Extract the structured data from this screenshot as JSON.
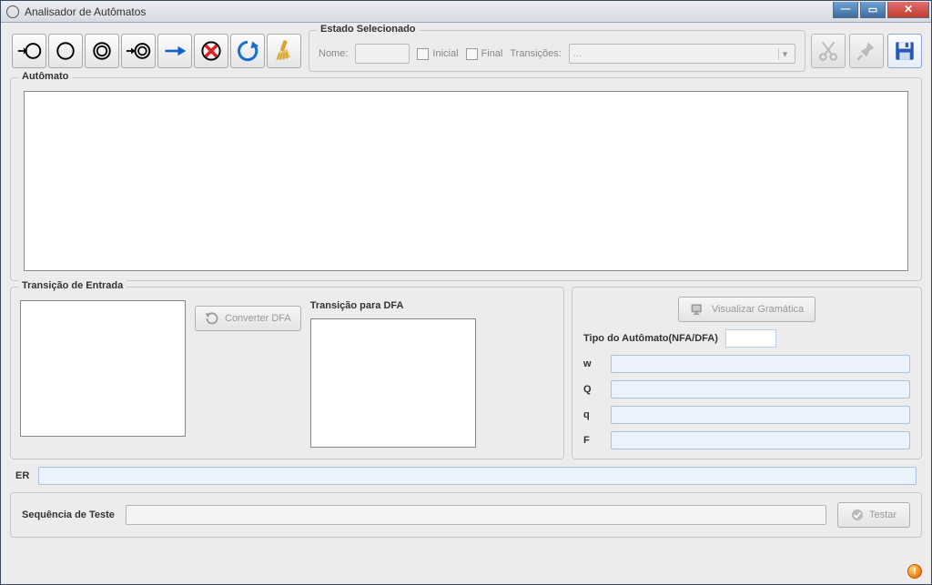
{
  "window": {
    "title": "Analisador de Autômatos"
  },
  "state_panel": {
    "legend": "Estado Selecionado",
    "name_label": "Nome:",
    "name_value": "",
    "initial_label": "Inicial",
    "final_label": "Final",
    "transitions_label": "Transições:",
    "transitions_selected": "..."
  },
  "automaton_panel": {
    "legend": "Autômato"
  },
  "transition_in_panel": {
    "legend": "Transição de Entrada",
    "convert_label": "Converter DFA"
  },
  "transition_dfa_panel": {
    "legend": "Transição para DFA"
  },
  "info_panel": {
    "visualize_label": "Visualizar Gramática",
    "type_label": "Tipo do Autômato(NFA/DFA)",
    "type_value": "",
    "rows": {
      "w_key": "w",
      "w_val": "",
      "Q_key": "Q",
      "Q_val": "",
      "q_key": "q",
      "q_val": "",
      "F_key": "F",
      "F_val": ""
    }
  },
  "er": {
    "label": "ER",
    "value": ""
  },
  "sequence": {
    "label": "Sequência de Teste",
    "value": "",
    "test_label": "Testar"
  },
  "icons": {
    "tool1": "state-initial-icon",
    "tool2": "state-icon",
    "tool3": "state-accept-icon",
    "tool4": "state-initial-accept-icon",
    "tool5": "transition-icon",
    "tool6": "delete-icon",
    "tool7": "refresh-icon",
    "tool8": "clear-icon",
    "cut": "cut-icon",
    "pin": "pin-icon",
    "save": "save-icon"
  }
}
